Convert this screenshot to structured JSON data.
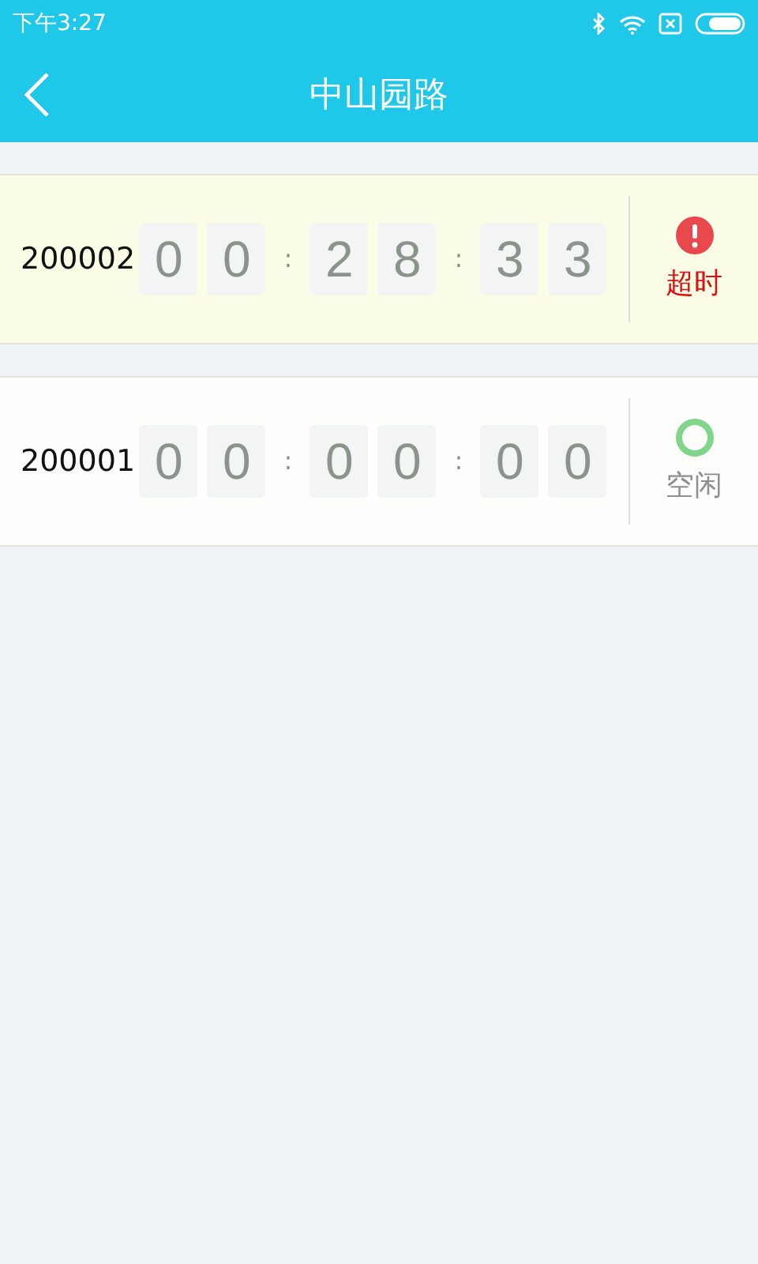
{
  "status_bar": {
    "time": "下午3:27"
  },
  "header": {
    "title": "中山园路"
  },
  "stations": [
    {
      "id": "200002",
      "kind": "overtime",
      "digits": [
        "0",
        "0",
        "2",
        "8",
        "3",
        "3"
      ],
      "separators": [
        ":",
        ":"
      ],
      "status": "超时"
    },
    {
      "id": "200001",
      "kind": "idle",
      "digits": [
        "0",
        "0",
        "0",
        "0",
        "0",
        "0"
      ],
      "separators": [
        ":",
        ":"
      ],
      "status": "空闲"
    }
  ]
}
